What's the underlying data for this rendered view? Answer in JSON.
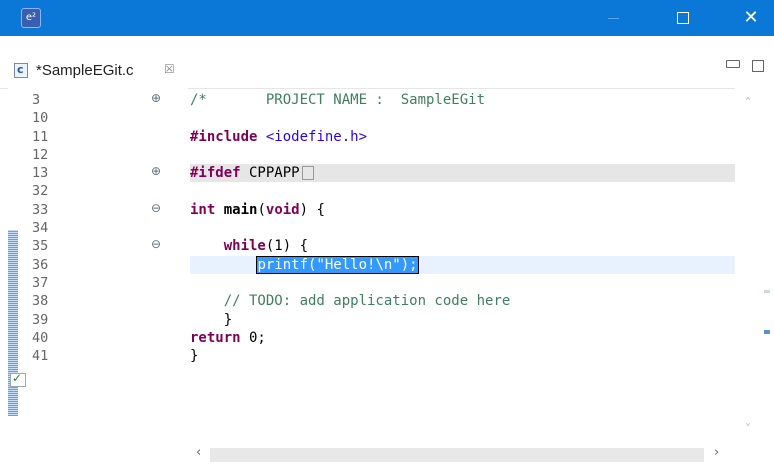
{
  "window": {
    "app_icon_text": "e²",
    "close_glyph": "✕"
  },
  "tab": {
    "label": "*SampleEGit.c",
    "close_glyph": "☒"
  },
  "icons": {
    "file": "c-source-file-icon",
    "fold": "fold-toggle-icon",
    "task": "task-marker-icon"
  },
  "colors": {
    "titlebar": "#0b78d7",
    "keyword": "#7f0055",
    "comment": "#3f7f5f",
    "string": "#2a00ff",
    "selection": "#3399ff"
  },
  "editor": {
    "line_numbers": [
      "3",
      "10",
      "11",
      "12",
      "13",
      "32",
      "33",
      "34",
      "35",
      "36",
      "37",
      "38",
      "39",
      "40",
      "41"
    ],
    "code": {
      "l3_comment": "/*       PROJECT NAME :  SampleEGit",
      "l11_directive": "#include",
      "l11_header": "<iodefine.h>",
      "l13_directive": "#ifdef",
      "l13_rest": " CPPAPP",
      "l33_type": "int",
      "l33_name": "main",
      "l33_param": "void",
      "l33_rest": ") {",
      "l35_kw": "while",
      "l35_rest": "(1) {",
      "l36_selected": "printf(\"Hello!\\n\");",
      "l38_comment": "// TODO: add application code here",
      "l39_brace": "    }",
      "l40_kw": "return",
      "l40_rest": " 0;",
      "l41_brace": "}"
    },
    "fold_glyphs": {
      "plus": "⊕",
      "minus": "⊖"
    }
  },
  "scroll": {
    "up": "˄",
    "down": "˅",
    "left": "‹",
    "right": "›"
  }
}
